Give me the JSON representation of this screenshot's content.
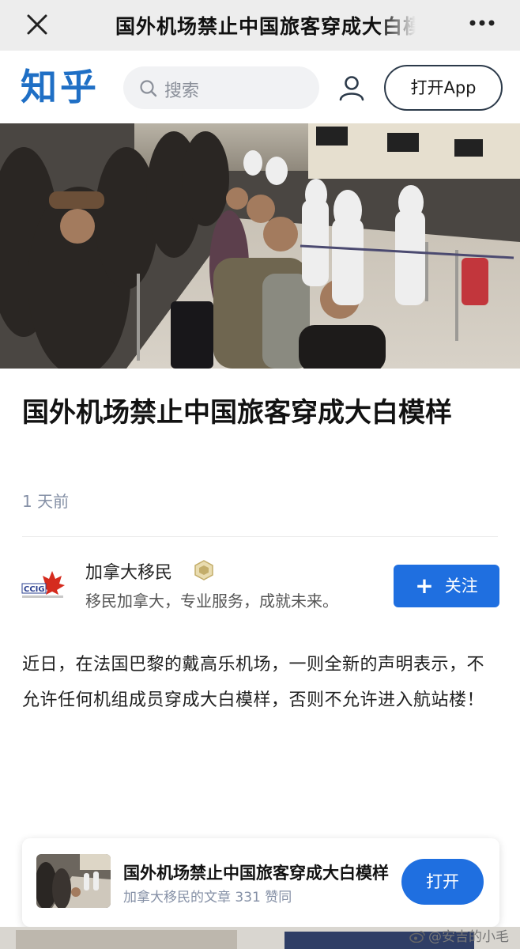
{
  "window": {
    "title": "国外机场禁止中国旅客穿成大白模样",
    "close_icon": "close-icon",
    "more_icon": "more-dots-icon"
  },
  "header": {
    "logo": "知乎",
    "search_placeholder": "搜索",
    "user_icon": "user-icon",
    "open_app_label": "打开App"
  },
  "hero": {
    "image": "airport-queue-photo"
  },
  "article": {
    "title": "国外机场禁止中国旅客穿成大白模样",
    "date": "1 天前",
    "author": {
      "logo_text": "CCIG",
      "name": "加拿大移民",
      "description": "移民加拿大，专业服务，成就未来。",
      "follow_label": "关注"
    },
    "body": "近日，在法国巴黎的戴高乐机场，一则全新的声明表示，不允许任何机组成员穿成大白模样，否则不允许进入航站楼！"
  },
  "card": {
    "title": "国外机场禁止中国旅客穿成大白模样",
    "meta": "加拿大移民的文章 331 赞同",
    "open_label": "打开"
  },
  "watermark": "@安吉的小毛",
  "colors": {
    "brand_blue": "#1f6fe0",
    "logo_blue": "#1f6fc5",
    "titlebar_bg": "#ededed"
  }
}
